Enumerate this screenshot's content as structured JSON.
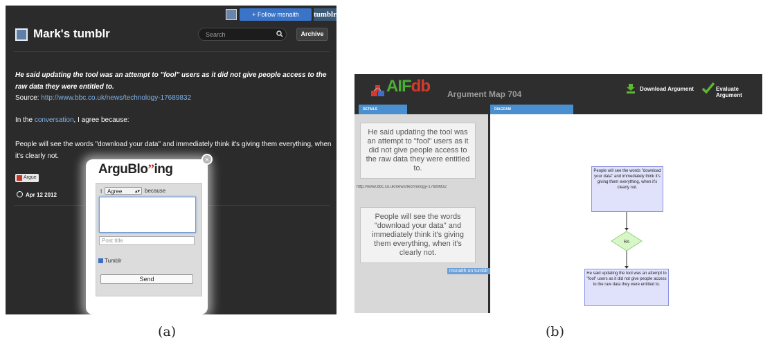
{
  "panel_a": {
    "caption": "(a)",
    "follow_button": "+ Follow msnaith",
    "tumblr_badge": "tumblr.",
    "blog_title": "Mark's tumblr",
    "search_placeholder": "Search",
    "archive_button": "Archive",
    "post_quote": "He said updating the tool was an attempt to \"fool\" users as it did not give people access to the raw data they were entitled to.",
    "source_label": "Source:",
    "source_url": "http://www.bbc.co.uk/news/technology-17689832",
    "context_before": "In the",
    "context_link": "conversation",
    "context_after": ", I agree because:",
    "post_body": "People will see the words \"download your data\" and immediately think it's giving them everything, when it's clearly not.",
    "tag_label": "Argue",
    "post_date": "Apr 12 2012",
    "popup": {
      "title_prefix": "ArguBlo",
      "title_quote": "”",
      "title_suffix": "ing",
      "close_symbol": "×",
      "i_label": "I",
      "stance_value": "Agree",
      "because_label": "because",
      "post_title_placeholder": "Post title",
      "tumblr_checkbox_label": "Tumblr",
      "send_button": "Send"
    }
  },
  "panel_b": {
    "caption": "(b)",
    "logo_text_main": "AIF",
    "logo_text_db": "db",
    "map_title": "Argument Map 704",
    "download_label": "Download Argument",
    "evaluate_label": "Evaluate Argument",
    "details_tab": "DETAILS",
    "diagram_tab": "DIAGRAM",
    "details_card_1": "He said updating the tool was an attempt to \"fool\" users as it did not give people access to the raw data they were entitled to.",
    "details_url": "http://www.bbc.co.uk/news/technology-17689832",
    "details_card_2": "People will see the words \"download your data\" and immediately think it's giving them everything, when it's clearly not.",
    "details_user": "msnaith on tumblr",
    "node_top": "People will see the words \"download your data\" and immediately think it's giving them everything, when it's clearly not.",
    "node_ra": "RA",
    "node_bottom": "He said updating the tool was an attempt to \"fool\" users as it did not give people access to the raw data they were entitled to.",
    "colors": {
      "panel_bg": "#2e2e2e",
      "tab_blue": "#4a90d0",
      "node_fill": "#e0e2fb",
      "ra_fill": "#d8f7c8"
    }
  },
  "colors": {
    "tumblr_bg": "#2b2b2b",
    "link_blue": "#7fb1e8",
    "follow_blue": "#3a74c9",
    "argu_red": "#c62b1f"
  }
}
